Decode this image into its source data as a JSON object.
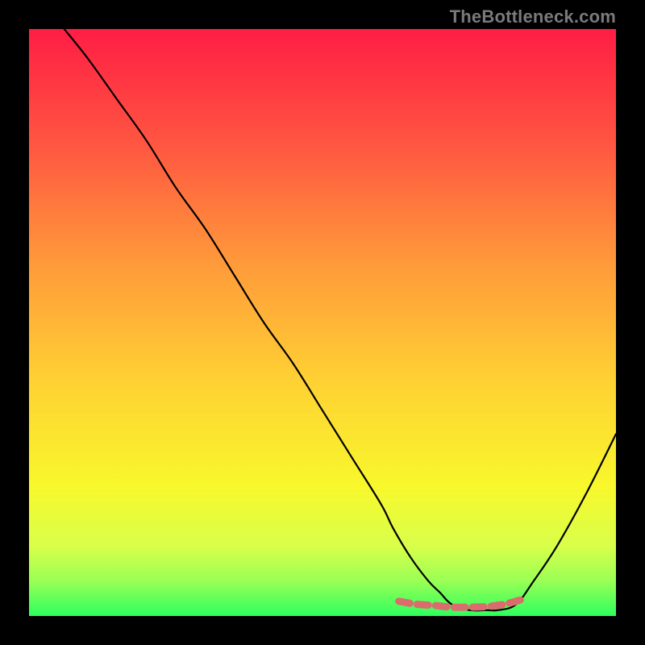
{
  "watermark": "TheBottleneck.com",
  "chart_data": {
    "type": "line",
    "title": "",
    "xlabel": "",
    "ylabel": "",
    "xlim": [
      0,
      100
    ],
    "ylim": [
      0,
      100
    ],
    "grid": false,
    "legend": false,
    "series": [
      {
        "name": "bottleneck-curve",
        "x": [
          6,
          10,
          15,
          20,
          25,
          30,
          35,
          40,
          45,
          50,
          55,
          60,
          62,
          65,
          68,
          70,
          72,
          75,
          78,
          80,
          83,
          86,
          90,
          95,
          100
        ],
        "y": [
          100,
          95,
          88,
          81,
          73,
          66,
          58,
          50,
          43,
          35,
          27,
          19,
          15,
          10,
          6,
          4,
          2,
          1,
          1,
          1,
          2,
          6,
          12,
          21,
          31
        ],
        "color": "#000000"
      },
      {
        "name": "optimal-band-marker",
        "x": [
          63,
          66,
          69,
          72,
          75,
          78,
          81,
          84
        ],
        "y": [
          2.5,
          2.0,
          1.8,
          1.5,
          1.5,
          1.6,
          2.0,
          2.8
        ],
        "color": "#d96d6d",
        "style": "dashed-thick"
      }
    ],
    "background_gradient": {
      "stops": [
        {
          "offset": 0.0,
          "color": "#ff1d44"
        },
        {
          "offset": 0.2,
          "color": "#ff5741"
        },
        {
          "offset": 0.4,
          "color": "#ff9a3a"
        },
        {
          "offset": 0.6,
          "color": "#ffd133"
        },
        {
          "offset": 0.78,
          "color": "#f8f82c"
        },
        {
          "offset": 0.88,
          "color": "#d9ff4a"
        },
        {
          "offset": 0.94,
          "color": "#9aff55"
        },
        {
          "offset": 1.0,
          "color": "#2dff5e"
        }
      ]
    }
  }
}
